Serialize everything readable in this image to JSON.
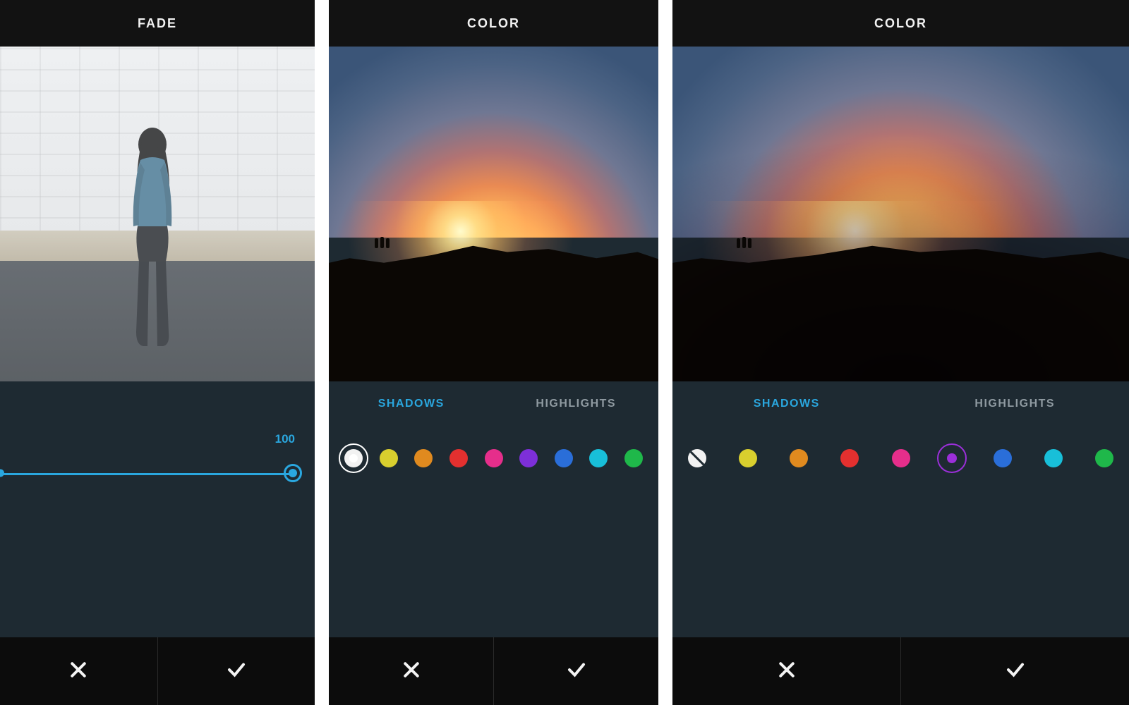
{
  "accent_color": "#2aa7df",
  "screens": [
    {
      "id": "fade",
      "title": "FADE",
      "slider": {
        "min": 0,
        "max": 100,
        "value": 100,
        "value_label": "100"
      }
    },
    {
      "id": "color-a",
      "title": "COLOR",
      "tabs": {
        "shadows": "SHADOWS",
        "highlights": "HIGHLIGHTS",
        "active": "shadows"
      },
      "swatches": [
        {
          "id": "none",
          "kind": "none",
          "hex": "#ffffff",
          "selected": true,
          "slash": false
        },
        {
          "id": "yellow",
          "kind": "color",
          "hex": "#d9cf2e",
          "selected": false
        },
        {
          "id": "orange",
          "kind": "color",
          "hex": "#e08a1f",
          "selected": false
        },
        {
          "id": "red",
          "kind": "color",
          "hex": "#e4302f",
          "selected": false
        },
        {
          "id": "pink",
          "kind": "color",
          "hex": "#e62e8b",
          "selected": false
        },
        {
          "id": "purple",
          "kind": "color",
          "hex": "#7d2fd9",
          "selected": false
        },
        {
          "id": "blue",
          "kind": "color",
          "hex": "#2a6ed9",
          "selected": false
        },
        {
          "id": "cyan",
          "kind": "color",
          "hex": "#18bfd9",
          "selected": false
        },
        {
          "id": "green",
          "kind": "color",
          "hex": "#1fb84a",
          "selected": false
        }
      ]
    },
    {
      "id": "color-b",
      "title": "COLOR",
      "tabs": {
        "shadows": "SHADOWS",
        "highlights": "HIGHLIGHTS",
        "active": "shadows"
      },
      "swatches": [
        {
          "id": "none",
          "kind": "none",
          "hex": "#ffffff",
          "selected": false,
          "slash": true
        },
        {
          "id": "yellow",
          "kind": "color",
          "hex": "#d9cf2e",
          "selected": false
        },
        {
          "id": "orange",
          "kind": "color",
          "hex": "#e08a1f",
          "selected": false
        },
        {
          "id": "red",
          "kind": "color",
          "hex": "#e4302f",
          "selected": false
        },
        {
          "id": "pink",
          "kind": "color",
          "hex": "#e62e8b",
          "selected": false
        },
        {
          "id": "purple",
          "kind": "color",
          "hex": "#9b2fd9",
          "selected": true
        },
        {
          "id": "blue",
          "kind": "color",
          "hex": "#2a6ed9",
          "selected": false
        },
        {
          "id": "cyan",
          "kind": "color",
          "hex": "#18bfd9",
          "selected": false
        },
        {
          "id": "green",
          "kind": "color",
          "hex": "#1fb84a",
          "selected": false
        }
      ]
    }
  ],
  "icons": {
    "cancel": "close-icon",
    "confirm": "check-icon"
  }
}
